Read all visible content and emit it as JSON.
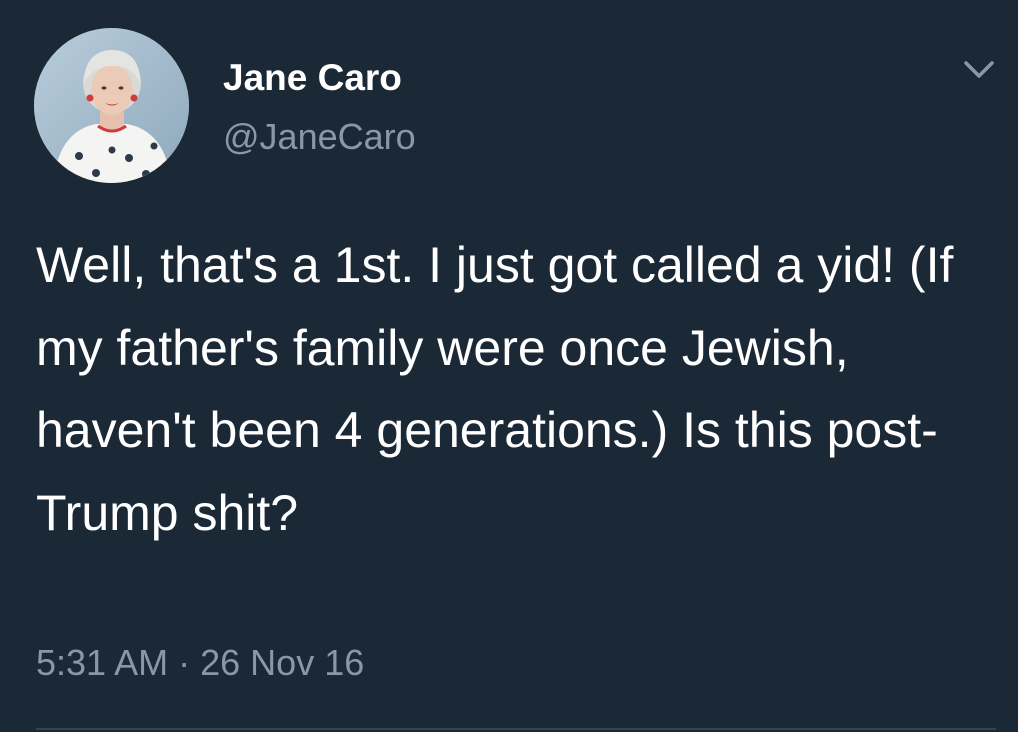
{
  "tweet": {
    "author": {
      "display_name": "Jane Caro",
      "handle": "@JaneCaro",
      "avatar_icon": "profile-photo"
    },
    "menu_icon": "chevron-down-icon",
    "text": "Well, that's a 1st. I just got called a yid! (If my father's family were once Jewish, haven't been 4 generations.) Is this post-Trump shit?",
    "time": "5:31 AM",
    "separator": "·",
    "date": "26 Nov 16"
  },
  "colors": {
    "background": "#1b2836",
    "primary_text": "#ffffff",
    "secondary_text": "#8899a6",
    "divider": "#38444d"
  }
}
